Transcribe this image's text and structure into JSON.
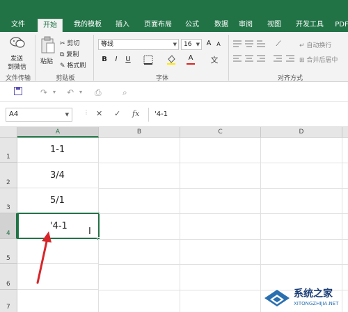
{
  "ribbon_tabs": [
    {
      "label": "文件"
    },
    {
      "label": "开始"
    },
    {
      "label": "我的模板"
    },
    {
      "label": "插入"
    },
    {
      "label": "页面布局"
    },
    {
      "label": "公式"
    },
    {
      "label": "数据"
    },
    {
      "label": "审阅"
    },
    {
      "label": "视图"
    },
    {
      "label": "开发工具"
    },
    {
      "label": "PDF"
    }
  ],
  "active_tab": "开始",
  "ribbon": {
    "send_label_1": "发送",
    "send_label_2": "到微信",
    "group_file_transfer": "文件传输",
    "paste_label": "粘贴",
    "cut_label": "剪切",
    "copy_label": "复制",
    "format_painter_label": "格式刷",
    "group_clipboard": "剪贴板",
    "font_name": "等线",
    "font_size": "16",
    "grow_font": "A",
    "shrink_font": "A",
    "bold": "B",
    "italic": "I",
    "underline": "U",
    "font_color_letter": "A",
    "group_font": "字体",
    "wrap_text_label": "自动换行",
    "merge_center_label": "合并后居中",
    "group_alignment": "对齐方式"
  },
  "formula_bar": {
    "name_box": "A4",
    "fx_label": "fx",
    "formula_value": "'4-1"
  },
  "columns": [
    "A",
    "B",
    "C",
    "D"
  ],
  "rows": [
    {
      "num": "1",
      "a": "1-1"
    },
    {
      "num": "2",
      "a": "3/4"
    },
    {
      "num": "3",
      "a": "5/1"
    },
    {
      "num": "4",
      "a": "'4-1"
    },
    {
      "num": "5",
      "a": ""
    },
    {
      "num": "6",
      "a": ""
    },
    {
      "num": "7",
      "a": ""
    }
  ],
  "selected_cell": "A4",
  "colors": {
    "excel_green": "#217346",
    "arrow_red": "#d7262b",
    "font_color_bar": "#e02020"
  },
  "watermark": {
    "main_text": "系统之家",
    "sub_text": "XITONGZHIJIA.NET"
  }
}
